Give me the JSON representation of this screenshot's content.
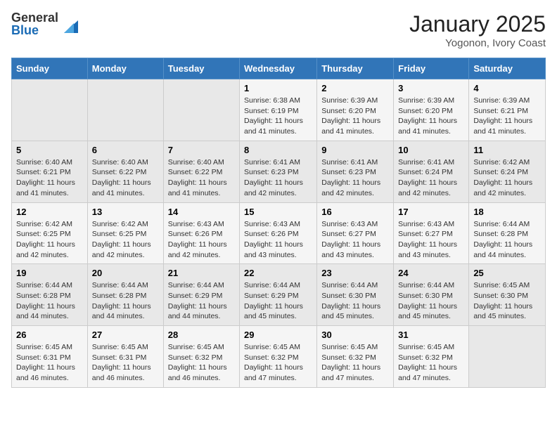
{
  "header": {
    "logo_general": "General",
    "logo_blue": "Blue",
    "month_title": "January 2025",
    "location": "Yogonon, Ivory Coast"
  },
  "weekdays": [
    "Sunday",
    "Monday",
    "Tuesday",
    "Wednesday",
    "Thursday",
    "Friday",
    "Saturday"
  ],
  "weeks": [
    [
      {
        "day": "",
        "info": ""
      },
      {
        "day": "",
        "info": ""
      },
      {
        "day": "",
        "info": ""
      },
      {
        "day": "1",
        "info": "Sunrise: 6:38 AM\nSunset: 6:19 PM\nDaylight: 11 hours and 41 minutes."
      },
      {
        "day": "2",
        "info": "Sunrise: 6:39 AM\nSunset: 6:20 PM\nDaylight: 11 hours and 41 minutes."
      },
      {
        "day": "3",
        "info": "Sunrise: 6:39 AM\nSunset: 6:20 PM\nDaylight: 11 hours and 41 minutes."
      },
      {
        "day": "4",
        "info": "Sunrise: 6:39 AM\nSunset: 6:21 PM\nDaylight: 11 hours and 41 minutes."
      }
    ],
    [
      {
        "day": "5",
        "info": "Sunrise: 6:40 AM\nSunset: 6:21 PM\nDaylight: 11 hours and 41 minutes."
      },
      {
        "day": "6",
        "info": "Sunrise: 6:40 AM\nSunset: 6:22 PM\nDaylight: 11 hours and 41 minutes."
      },
      {
        "day": "7",
        "info": "Sunrise: 6:40 AM\nSunset: 6:22 PM\nDaylight: 11 hours and 41 minutes."
      },
      {
        "day": "8",
        "info": "Sunrise: 6:41 AM\nSunset: 6:23 PM\nDaylight: 11 hours and 42 minutes."
      },
      {
        "day": "9",
        "info": "Sunrise: 6:41 AM\nSunset: 6:23 PM\nDaylight: 11 hours and 42 minutes."
      },
      {
        "day": "10",
        "info": "Sunrise: 6:41 AM\nSunset: 6:24 PM\nDaylight: 11 hours and 42 minutes."
      },
      {
        "day": "11",
        "info": "Sunrise: 6:42 AM\nSunset: 6:24 PM\nDaylight: 11 hours and 42 minutes."
      }
    ],
    [
      {
        "day": "12",
        "info": "Sunrise: 6:42 AM\nSunset: 6:25 PM\nDaylight: 11 hours and 42 minutes."
      },
      {
        "day": "13",
        "info": "Sunrise: 6:42 AM\nSunset: 6:25 PM\nDaylight: 11 hours and 42 minutes."
      },
      {
        "day": "14",
        "info": "Sunrise: 6:43 AM\nSunset: 6:26 PM\nDaylight: 11 hours and 42 minutes."
      },
      {
        "day": "15",
        "info": "Sunrise: 6:43 AM\nSunset: 6:26 PM\nDaylight: 11 hours and 43 minutes."
      },
      {
        "day": "16",
        "info": "Sunrise: 6:43 AM\nSunset: 6:27 PM\nDaylight: 11 hours and 43 minutes."
      },
      {
        "day": "17",
        "info": "Sunrise: 6:43 AM\nSunset: 6:27 PM\nDaylight: 11 hours and 43 minutes."
      },
      {
        "day": "18",
        "info": "Sunrise: 6:44 AM\nSunset: 6:28 PM\nDaylight: 11 hours and 44 minutes."
      }
    ],
    [
      {
        "day": "19",
        "info": "Sunrise: 6:44 AM\nSunset: 6:28 PM\nDaylight: 11 hours and 44 minutes."
      },
      {
        "day": "20",
        "info": "Sunrise: 6:44 AM\nSunset: 6:28 PM\nDaylight: 11 hours and 44 minutes."
      },
      {
        "day": "21",
        "info": "Sunrise: 6:44 AM\nSunset: 6:29 PM\nDaylight: 11 hours and 44 minutes."
      },
      {
        "day": "22",
        "info": "Sunrise: 6:44 AM\nSunset: 6:29 PM\nDaylight: 11 hours and 45 minutes."
      },
      {
        "day": "23",
        "info": "Sunrise: 6:44 AM\nSunset: 6:30 PM\nDaylight: 11 hours and 45 minutes."
      },
      {
        "day": "24",
        "info": "Sunrise: 6:44 AM\nSunset: 6:30 PM\nDaylight: 11 hours and 45 minutes."
      },
      {
        "day": "25",
        "info": "Sunrise: 6:45 AM\nSunset: 6:30 PM\nDaylight: 11 hours and 45 minutes."
      }
    ],
    [
      {
        "day": "26",
        "info": "Sunrise: 6:45 AM\nSunset: 6:31 PM\nDaylight: 11 hours and 46 minutes."
      },
      {
        "day": "27",
        "info": "Sunrise: 6:45 AM\nSunset: 6:31 PM\nDaylight: 11 hours and 46 minutes."
      },
      {
        "day": "28",
        "info": "Sunrise: 6:45 AM\nSunset: 6:32 PM\nDaylight: 11 hours and 46 minutes."
      },
      {
        "day": "29",
        "info": "Sunrise: 6:45 AM\nSunset: 6:32 PM\nDaylight: 11 hours and 47 minutes."
      },
      {
        "day": "30",
        "info": "Sunrise: 6:45 AM\nSunset: 6:32 PM\nDaylight: 11 hours and 47 minutes."
      },
      {
        "day": "31",
        "info": "Sunrise: 6:45 AM\nSunset: 6:32 PM\nDaylight: 11 hours and 47 minutes."
      },
      {
        "day": "",
        "info": ""
      }
    ]
  ]
}
